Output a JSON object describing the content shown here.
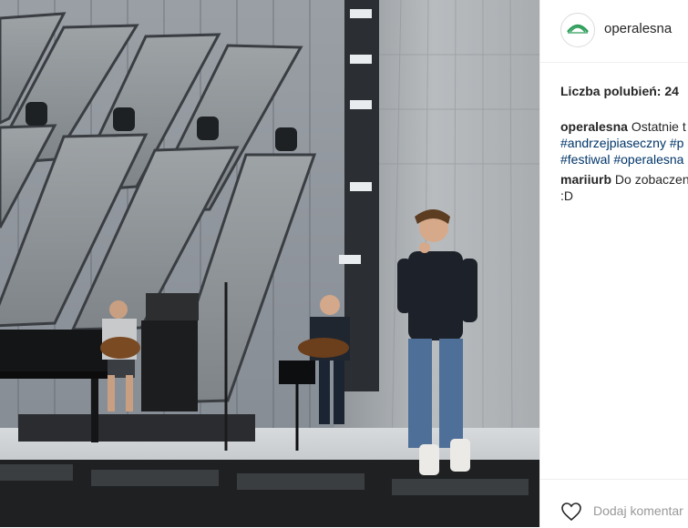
{
  "post": {
    "username": "operalesna",
    "avatar_label": "OPERALEŚNA",
    "likes_text": "Liczba polubień: 24",
    "caption": {
      "user": "operalesna",
      "text_start": "Ostatnie t",
      "tags": [
        "#andrzejpiaseczny",
        "#p",
        "#festiwal",
        "#operalesna"
      ]
    },
    "comments": [
      {
        "user": "mariiurb",
        "text_start": "Do zobaczen",
        "text_end": ":D"
      }
    ],
    "add_comment_placeholder": "Dodaj komentar"
  },
  "icons": {
    "like": "heart-outline-icon"
  },
  "colors": {
    "link": "#003569",
    "text": "#262626",
    "muted": "#999999",
    "brand_green": "#2e9e5a"
  }
}
